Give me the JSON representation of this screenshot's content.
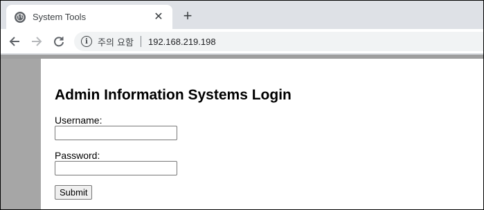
{
  "browser": {
    "tab": {
      "title": "System Tools",
      "close_glyph": "✕",
      "favicon": "globe-icon"
    },
    "new_tab_glyph": "+",
    "toolbar": {
      "back_icon": "arrow-left-icon",
      "forward_icon": "arrow-right-icon",
      "reload_icon": "reload-icon",
      "security_label": "주의 요함",
      "url": "192.168.219.198"
    }
  },
  "page": {
    "title": "Admin Information Systems Login",
    "username_label": "Username:",
    "username_value": "",
    "password_label": "Password:",
    "password_value": "",
    "submit_label": "Submit"
  },
  "colors": {
    "tabstrip_bg": "#dee1e6",
    "viewport_bg": "#a6a6a6",
    "page_bg": "#ffffff"
  }
}
